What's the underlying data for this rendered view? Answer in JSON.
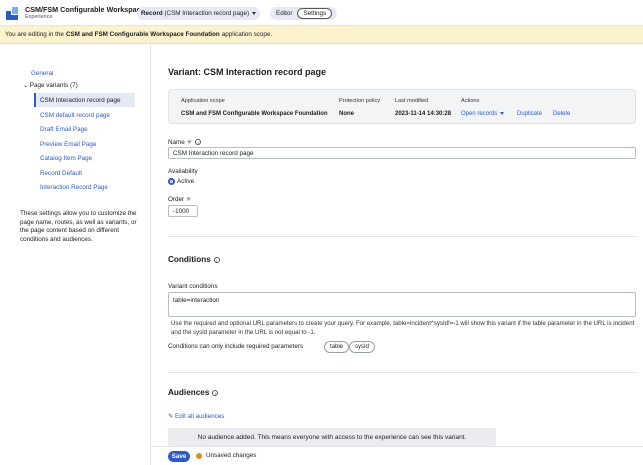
{
  "header": {
    "title": "CSM/FSM Configurable Workspace",
    "subtitle": "Experience",
    "record_pill_bold": "Record",
    "record_pill_rest": "(CSM Interaction record page)",
    "mode_editor": "Editor",
    "mode_settings": "Settings"
  },
  "banner": {
    "prefix": "You are editing in the",
    "scope": "CSM and FSM Configurable Workspace Foundation",
    "suffix": "application scope."
  },
  "sidebar": {
    "general": "General",
    "group_label": "Page variants (7)",
    "items": [
      "CSM Interaction record page",
      "CSM default record page",
      "Draft Email Page",
      "Preview Email Page",
      "Catalog Item Page",
      "Record Default",
      "Interaction Record Page"
    ],
    "description": "These settings allow you to customize the page name, routes, as well as variants, or the page content based on different conditions and audiences."
  },
  "main": {
    "title": "Variant: CSM Interaction record page",
    "info": {
      "h_scope": "Application scope",
      "h_protection": "Protection policy",
      "h_modified": "Last modified",
      "h_actions": "Actions",
      "scope": "CSM and FSM Configurable Workspace Foundation",
      "protection": "None",
      "modified": "2023-11-14 14:30:28",
      "open_records": "Open records",
      "duplicate": "Duplicate",
      "delete": "Delete"
    },
    "name_label": "Name",
    "name_value": "CSM Interaction record page",
    "availability_label": "Availability",
    "availability_value": "Active",
    "order_label": "Order",
    "order_value": "-1000",
    "conditions_title": "Conditions",
    "variant_conditions_label": "Variant conditions",
    "variant_conditions_value": "table=interaction",
    "conditions_help": "Use the required and optional URL parameters to create your query. For example, table=incident^sysId!=-1 will show this variant if the table parameter in the URL is incident and the sysId parameter in the URL is not equal to -1.",
    "required_params_label": "Conditions can only include required parameters",
    "params": [
      "table",
      "sysId"
    ],
    "audiences_title": "Audiences",
    "edit_audiences": "Edit all audiences",
    "no_audience": "No audience added. This means everyone with access to the experience can see this variant."
  },
  "footer": {
    "save": "Save",
    "unsaved": "Unsaved changes"
  }
}
